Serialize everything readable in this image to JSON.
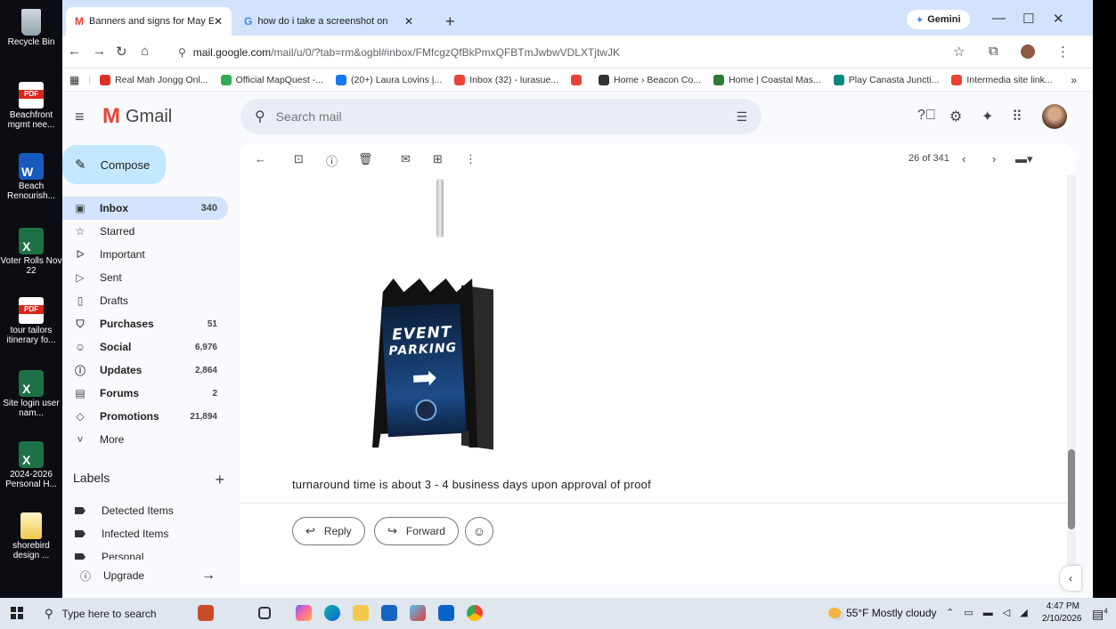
{
  "desktop": {
    "icons": [
      {
        "label": "Recycle Bin",
        "type": "bin"
      },
      {
        "label": "Beachfront mgmt nee...",
        "type": "pdf"
      },
      {
        "label": "Beach Renourish...",
        "type": "word"
      },
      {
        "label": "Voter Rolls Nov 22",
        "type": "excel"
      },
      {
        "label": "tour tailors itinerary fo...",
        "type": "pdf"
      },
      {
        "label": "Site login user nam...",
        "type": "excel"
      },
      {
        "label": "2024-2026 Personal H...",
        "type": "excel"
      },
      {
        "label": "shorebird design ...",
        "type": "folder"
      }
    ]
  },
  "browser": {
    "tabs": [
      {
        "title": "Banners and signs for May Even",
        "favicon": "M",
        "active": true
      },
      {
        "title": "how do i take a screenshot on",
        "favicon": "G",
        "active": false
      }
    ],
    "new_tab": "+",
    "gemini_label": "Gemini",
    "url_host": "mail.google.com",
    "url_path": "/mail/u/0/?tab=rm&ogbl#inbox/FMfcgzQfBkPmxQFBTmJwbwVDLXTjtwJK",
    "bookmarks": [
      {
        "label": "Real Mah Jongg Onl...",
        "color": "#d93025"
      },
      {
        "label": "Official MapQuest -...",
        "color": "#34a853"
      },
      {
        "label": "(20+) Laura Lovins |...",
        "color": "#1877f2"
      },
      {
        "label": "Inbox (32) - lurasue...",
        "color": "#ea4335"
      },
      {
        "label": "",
        "color": "#ea4335"
      },
      {
        "label": "Home › Beacon Co...",
        "color": "#333333"
      },
      {
        "label": "Home | Coastal Mas...",
        "color": "#2e7d32"
      },
      {
        "label": "Play Canasta Juncti...",
        "color": "#00897b"
      },
      {
        "label": "Intermedia site link...",
        "color": "#ea4335"
      }
    ],
    "bookmarks_more": "»"
  },
  "gmail": {
    "brand": "Gmail",
    "search_placeholder": "Search mail",
    "compose_label": "Compose",
    "nav": [
      {
        "label": "Inbox",
        "count": "340",
        "icon": "inbox-icon",
        "glyph": "▣",
        "active": true,
        "bold": true
      },
      {
        "label": "Starred",
        "count": "",
        "icon": "star-icon",
        "glyph": "☆",
        "active": false,
        "bold": false
      },
      {
        "label": "Important",
        "count": "",
        "icon": "important-icon",
        "glyph": "ᐅ",
        "active": false,
        "bold": false
      },
      {
        "label": "Sent",
        "count": "",
        "icon": "send-icon",
        "glyph": "▷",
        "active": false,
        "bold": false
      },
      {
        "label": "Drafts",
        "count": "",
        "icon": "draft-icon",
        "glyph": "▯",
        "active": false,
        "bold": false
      },
      {
        "label": "Purchases",
        "count": "51",
        "icon": "purchases-icon",
        "glyph": "⛉",
        "active": false,
        "bold": true
      },
      {
        "label": "Social",
        "count": "6,976",
        "icon": "social-icon",
        "glyph": "☺",
        "active": false,
        "bold": true
      },
      {
        "label": "Updates",
        "count": "2,864",
        "icon": "updates-icon",
        "glyph": "ⓘ",
        "active": false,
        "bold": true
      },
      {
        "label": "Forums",
        "count": "2",
        "icon": "forums-icon",
        "glyph": "▤",
        "active": false,
        "bold": true
      },
      {
        "label": "Promotions",
        "count": "21,894",
        "icon": "promotions-icon",
        "glyph": "◇",
        "active": false,
        "bold": true
      },
      {
        "label": "More",
        "count": "",
        "icon": "chevron-down-icon",
        "glyph": "˅",
        "active": false,
        "bold": false
      }
    ],
    "labels_heading": "Labels",
    "labels": [
      "Detected Items",
      "Infected Items",
      "Personal"
    ],
    "upgrade_label": "Upgrade",
    "pager": "26 of 341",
    "sign": {
      "line1": "EVENT",
      "line2": "PARKING"
    },
    "body_text": "turnaround time is about 3 - 4 business days upon approval of proof",
    "reply_label": "Reply",
    "forward_label": "Forward"
  },
  "taskbar": {
    "search_placeholder": "Type here to search",
    "weather": "55°F  Mostly cloudy",
    "time": "4:47 PM",
    "date": "2/10/2026",
    "notifications": "4"
  }
}
